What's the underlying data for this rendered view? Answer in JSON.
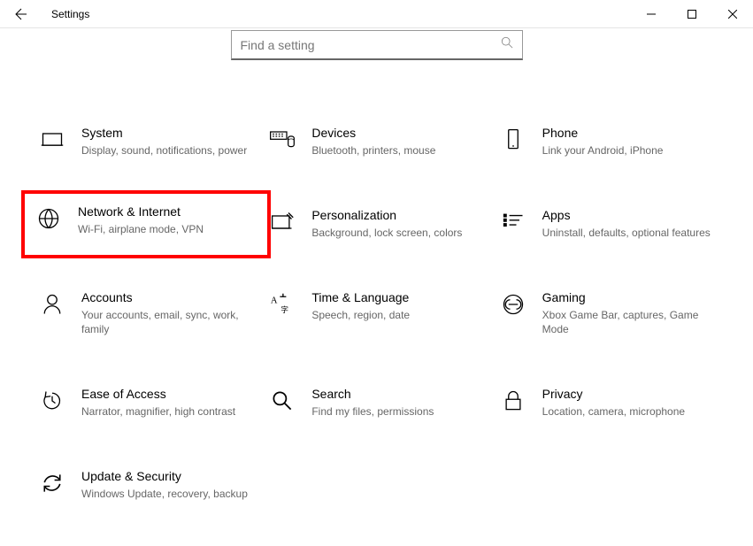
{
  "window": {
    "title": "Settings"
  },
  "search": {
    "placeholder": "Find a setting"
  },
  "tiles": [
    {
      "id": "system",
      "title": "System",
      "desc": "Display, sound, notifications, power",
      "highlighted": false
    },
    {
      "id": "devices",
      "title": "Devices",
      "desc": "Bluetooth, printers, mouse",
      "highlighted": false
    },
    {
      "id": "phone",
      "title": "Phone",
      "desc": "Link your Android, iPhone",
      "highlighted": false
    },
    {
      "id": "network",
      "title": "Network & Internet",
      "desc": "Wi-Fi, airplane mode, VPN",
      "highlighted": true
    },
    {
      "id": "personalization",
      "title": "Personalization",
      "desc": "Background, lock screen, colors",
      "highlighted": false
    },
    {
      "id": "apps",
      "title": "Apps",
      "desc": "Uninstall, defaults, optional features",
      "highlighted": false
    },
    {
      "id": "accounts",
      "title": "Accounts",
      "desc": "Your accounts, email, sync, work, family",
      "highlighted": false
    },
    {
      "id": "time",
      "title": "Time & Language",
      "desc": "Speech, region, date",
      "highlighted": false
    },
    {
      "id": "gaming",
      "title": "Gaming",
      "desc": "Xbox Game Bar, captures, Game Mode",
      "highlighted": false
    },
    {
      "id": "ease",
      "title": "Ease of Access",
      "desc": "Narrator, magnifier, high contrast",
      "highlighted": false
    },
    {
      "id": "search",
      "title": "Search",
      "desc": "Find my files, permissions",
      "highlighted": false
    },
    {
      "id": "privacy",
      "title": "Privacy",
      "desc": "Location, camera, microphone",
      "highlighted": false
    },
    {
      "id": "update",
      "title": "Update & Security",
      "desc": "Windows Update, recovery, backup",
      "highlighted": false
    }
  ]
}
